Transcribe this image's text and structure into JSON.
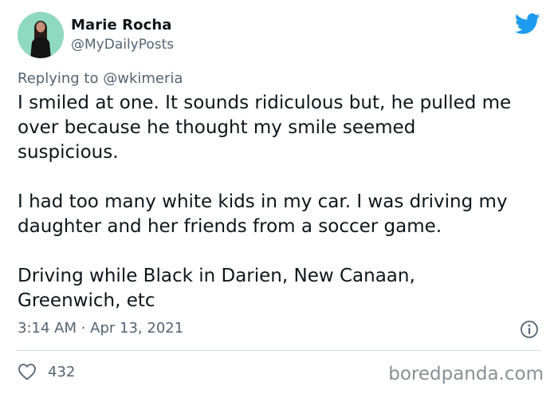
{
  "author": {
    "name": "Marie Rocha",
    "handle": "@MyDailyPosts",
    "avatar_icon": "user-avatar-photo"
  },
  "platform_icon": "twitter-bird-icon",
  "reply": {
    "prefix": "Replying to",
    "mention": "@wkimeria"
  },
  "tweet": {
    "paragraphs": [
      "I smiled at one. It sounds ridiculous but, he pulled me\nover because he thought my smile seemed\nsuspicious.",
      "I had too many white kids in my car. I was driving my\ndaughter and her friends from a soccer game.",
      "Driving while Black in Darien, New Canaan,\nGreenwich, etc"
    ],
    "timestamp": "3:14 AM · Apr 13, 2021"
  },
  "actions": {
    "like_count": "432"
  },
  "watermark": "boredpanda.com",
  "colors": {
    "text": "#0f1419",
    "secondary": "#536471",
    "twitter_blue": "#1d9bf0",
    "avatar_bg": "#8fd9c1"
  }
}
